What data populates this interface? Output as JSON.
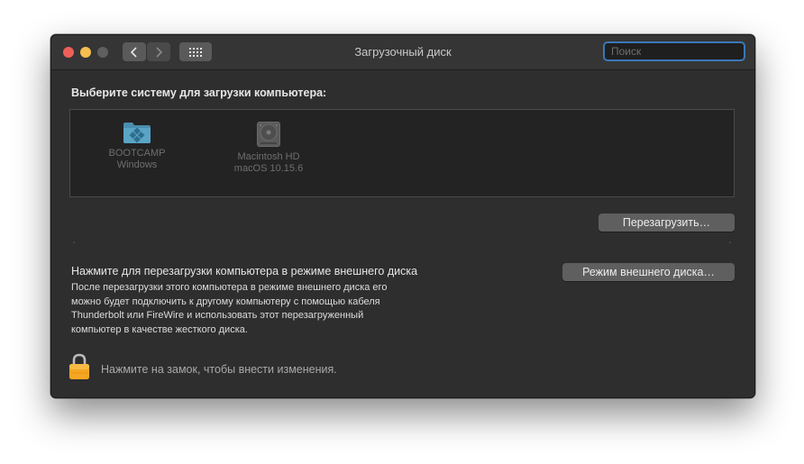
{
  "window": {
    "title": "Загрузочный диск"
  },
  "toolbar": {
    "back_icon": "chevron-left-icon",
    "forward_icon": "chevron-right-icon",
    "grid_icon": "grid-icon"
  },
  "search": {
    "placeholder": "Поиск",
    "value": ""
  },
  "main": {
    "heading": "Выберите систему для загрузки компьютера:",
    "disks": [
      {
        "name": "BOOTCAMP",
        "system": "Windows",
        "icon": "windows-folder-icon"
      },
      {
        "name": "Macintosh HD",
        "system": "macOS 10.15.6",
        "icon": "hard-drive-icon"
      }
    ],
    "restart_button": "Перезагрузить…",
    "target_mode": {
      "heading": "Нажмите для перезагрузки компьютера в режиме внешнего диска",
      "description": "После перезагрузки этого компьютера в режиме внешнего диска его\nможно будет подключить к другому компьютеру с помощью кабеля\nThunderbolt или FireWire и использовать этот перезагруженный\nкомпьютер в качестве жесткого диска.",
      "button": "Режим внешнего диска…"
    },
    "lock_text": "Нажмите на замок, чтобы внести изменения."
  },
  "colors": {
    "close": "#ee5f58",
    "minimize": "#f6be4f",
    "search_focus": "#3a78b8",
    "lock": "#f5a623"
  }
}
